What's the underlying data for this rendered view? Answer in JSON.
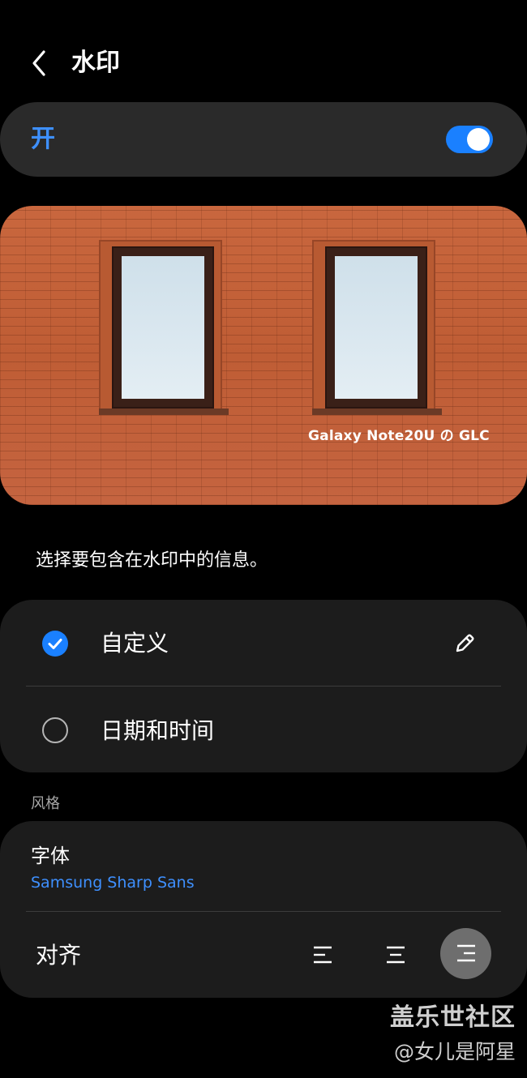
{
  "header": {
    "back_icon": "chevron-left-icon",
    "title": "水印"
  },
  "master_toggle": {
    "label": "开",
    "state": "on",
    "accent_color": "#1a80ff"
  },
  "preview": {
    "watermark_text": "Galaxy Note20U の GLC"
  },
  "description": "选择要包含在水印中的信息。",
  "options": [
    {
      "label": "自定义",
      "selected": true,
      "icon": "check-circle-icon",
      "action_icon": "pencil-icon"
    },
    {
      "label": "日期和时间",
      "selected": false,
      "icon": "radio-empty-icon"
    }
  ],
  "style_section": {
    "label": "风格",
    "font": {
      "title": "字体",
      "value": "Samsung Sharp Sans"
    },
    "alignment": {
      "label": "对齐",
      "buttons": [
        {
          "name": "align-left",
          "icon": "align-left-icon",
          "selected": false
        },
        {
          "name": "align-center",
          "icon": "align-center-icon",
          "selected": false
        },
        {
          "name": "align-right",
          "icon": "align-right-icon",
          "selected": true
        }
      ]
    }
  },
  "footer_watermark": {
    "site": "盖乐世社区",
    "user": "@女儿是阿星"
  }
}
